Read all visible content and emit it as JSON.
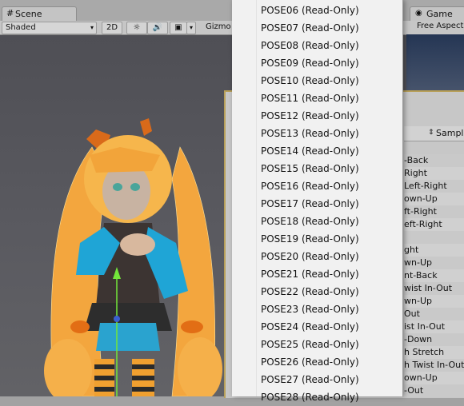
{
  "scene": {
    "tab_icon": "#",
    "tab_label": "Scene",
    "shading_mode": "Shaded",
    "mode_2d": "2D",
    "gizmos_label": "Gizmo"
  },
  "game": {
    "tab_label": "Game",
    "aspect_label": "Free Aspect"
  },
  "inspector": {
    "header_label": "Sample",
    "rows": [
      "-Back",
      "Right",
      "Left-Right",
      "own-Up",
      "ft-Right",
      "eft-Right",
      "",
      "ght",
      "wn-Up",
      "nt-Back",
      "wist In-Out",
      "wn-Up",
      "Out",
      "ist In-Out",
      "-Down",
      "h Stretch",
      "h Twist In-Out",
      "own-Up",
      "-Out"
    ]
  },
  "menu": {
    "items": [
      "POSE06 (Read-Only)",
      "POSE07 (Read-Only)",
      "POSE08 (Read-Only)",
      "POSE09 (Read-Only)",
      "POSE10 (Read-Only)",
      "POSE11 (Read-Only)",
      "POSE12 (Read-Only)",
      "POSE13 (Read-Only)",
      "POSE14 (Read-Only)",
      "POSE15 (Read-Only)",
      "POSE16 (Read-Only)",
      "POSE17 (Read-Only)",
      "POSE18 (Read-Only)",
      "POSE19 (Read-Only)",
      "POSE20 (Read-Only)",
      "POSE21 (Read-Only)",
      "POSE22 (Read-Only)",
      "POSE23 (Read-Only)",
      "POSE24 (Read-Only)",
      "POSE25 (Read-Only)",
      "POSE26 (Read-Only)",
      "POSE27 (Read-Only)",
      "POSE28 (Read-Only)"
    ]
  },
  "icons": {
    "scene_tab": "grid-icon",
    "lighting": "sun-icon",
    "audio": "speaker-icon",
    "effects": "image-icon",
    "game_tab": "gamepad-icon"
  }
}
